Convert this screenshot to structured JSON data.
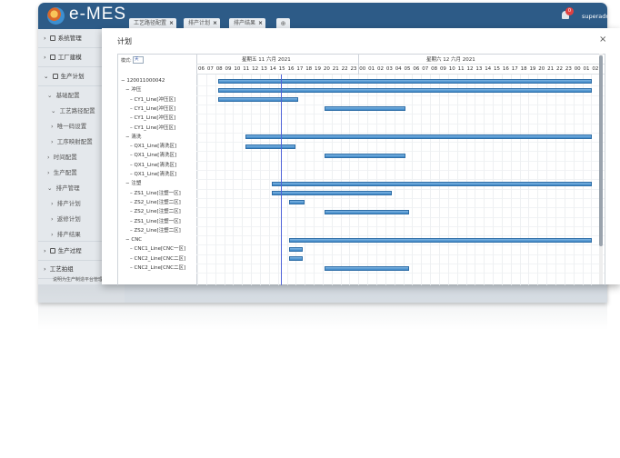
{
  "app": {
    "logo_text": "e-MES",
    "user": "superadmin",
    "notification_count": "0",
    "tabs": [
      {
        "label": "工艺路径配置"
      },
      {
        "label": "排产计划"
      },
      {
        "label": "排产结果"
      }
    ],
    "add_tab_icon": "plus-circle-icon"
  },
  "sidebar": {
    "items": [
      {
        "label": "系统管理",
        "icon": "gear-icon"
      },
      {
        "label": "工厂建模",
        "icon": "factory-icon"
      },
      {
        "label": "生产计划",
        "icon": "document-icon"
      },
      {
        "label": "基础配置"
      },
      {
        "label": "工艺路径配置"
      },
      {
        "label": "唯一码设置"
      },
      {
        "label": "工序映射配置"
      },
      {
        "label": "时间配置"
      },
      {
        "label": "生产配置"
      },
      {
        "label": "排产管理"
      },
      {
        "label": "排产计划"
      },
      {
        "label": "返修计划"
      },
      {
        "label": "排产结果"
      },
      {
        "label": "生产过程",
        "icon": "process-icon"
      },
      {
        "label": "工艺拍组"
      },
      {
        "label": "说明为生产制造平台管理"
      }
    ]
  },
  "dialog": {
    "title": "计划",
    "close_icon": "close-icon",
    "gantt": {
      "mode_label": "模式:",
      "mode_value": "天",
      "day_headers": [
        "星期五 11 六月 2021",
        "星期六 12 六月 2021"
      ],
      "hours": [
        "06",
        "07",
        "08",
        "09",
        "10",
        "11",
        "12",
        "13",
        "14",
        "15",
        "16",
        "17",
        "18",
        "19",
        "20",
        "21",
        "22",
        "23",
        "00",
        "01",
        "02",
        "03",
        "04",
        "05",
        "06",
        "07",
        "08",
        "09",
        "10",
        "11",
        "12",
        "13",
        "14",
        "15",
        "16",
        "17",
        "18",
        "19",
        "20",
        "21",
        "22",
        "23",
        "00",
        "01",
        "02"
      ],
      "rows": [
        {
          "label": "120011000042",
          "level": 0
        },
        {
          "label": "冲压",
          "level": 1
        },
        {
          "label": "CY1_Line[冲压区]",
          "level": 2
        },
        {
          "label": "CY1_Line[冲压区]",
          "level": 2
        },
        {
          "label": "CY1_Line[冲压区]",
          "level": 2
        },
        {
          "label": "CY1_Line[冲压区]",
          "level": 2
        },
        {
          "label": "清洗",
          "level": 1
        },
        {
          "label": "QX1_Line[清洗区]",
          "level": 2
        },
        {
          "label": "QX1_Line[清洗区]",
          "level": 2
        },
        {
          "label": "QX1_Line[清洗区]",
          "level": 2
        },
        {
          "label": "QX1_Line[清洗区]",
          "level": 2
        },
        {
          "label": "注塑",
          "level": 1
        },
        {
          "label": "ZS1_Line[注塑一区]",
          "level": 2
        },
        {
          "label": "ZS2_Line[注塑二区]",
          "level": 2
        },
        {
          "label": "ZS2_Line[注塑二区]",
          "level": 2
        },
        {
          "label": "ZS1_Line[注塑一区]",
          "level": 2
        },
        {
          "label": "ZS2_Line[注塑二区]",
          "level": 2
        },
        {
          "label": "CNC",
          "level": 1
        },
        {
          "label": "CNC1_Line[CNC一区]",
          "level": 2
        },
        {
          "label": "CNC2_Line[CNC二区]",
          "level": 2
        },
        {
          "label": "CNC2_Line[CNC二区]",
          "level": 2
        }
      ],
      "tasks": [
        {
          "row": 0,
          "start": 8.2,
          "end": 50
        },
        {
          "row": 1,
          "start": 8.2,
          "end": 50
        },
        {
          "row": 2,
          "start": 8.2,
          "end": 17.2
        },
        {
          "row": 3,
          "start": 20.1,
          "end": 29.1
        },
        {
          "row": 6,
          "start": 11.3,
          "end": 50
        },
        {
          "row": 7,
          "start": 11.3,
          "end": 16.9
        },
        {
          "row": 8,
          "start": 20.1,
          "end": 29.1
        },
        {
          "row": 11,
          "start": 14.2,
          "end": 50
        },
        {
          "row": 12,
          "start": 14.2,
          "end": 27.6
        },
        {
          "row": 13,
          "start": 16.2,
          "end": 17.9
        },
        {
          "row": 14,
          "start": 20.1,
          "end": 29.6
        },
        {
          "row": 17,
          "start": 16.2,
          "end": 50
        },
        {
          "row": 18,
          "start": 16.2,
          "end": 17.7
        },
        {
          "row": 19,
          "start": 16.2,
          "end": 17.7
        },
        {
          "row": 20,
          "start": 20.1,
          "end": 29.6
        }
      ],
      "today_hour": 15.2
    }
  }
}
